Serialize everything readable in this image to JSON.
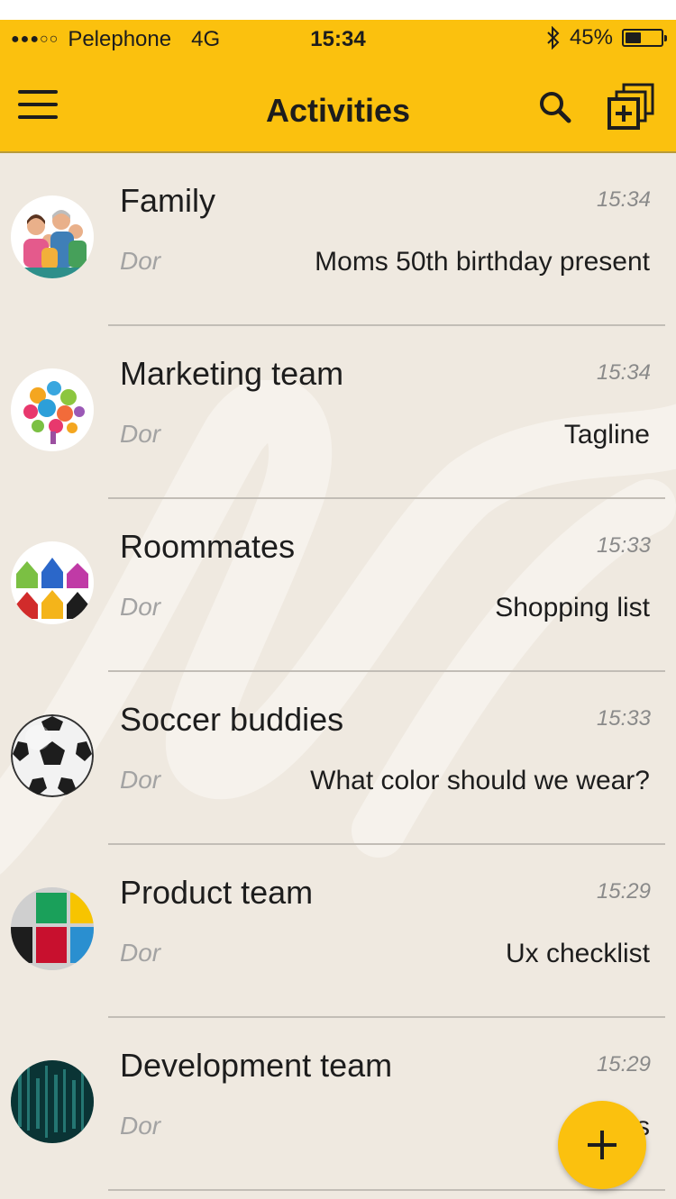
{
  "status_bar": {
    "carrier": "Pelephone",
    "network": "4G",
    "time": "15:34",
    "battery_percent": "45%",
    "battery_level": 0.45,
    "signal_dots": "●●●○○"
  },
  "header": {
    "title": "Activities"
  },
  "activities": [
    {
      "name": "Family",
      "time": "15:34",
      "sender": "Dor",
      "message": "Moms 50th birthday present"
    },
    {
      "name": "Marketing team",
      "time": "15:34",
      "sender": "Dor",
      "message": "Tagline"
    },
    {
      "name": "Roommates",
      "time": "15:33",
      "sender": "Dor",
      "message": "Shopping list"
    },
    {
      "name": "Soccer buddies",
      "time": "15:33",
      "sender": "Dor",
      "message": "What color should we wear?"
    },
    {
      "name": "Product team",
      "time": "15:29",
      "sender": "Dor",
      "message": "Ux checklist"
    },
    {
      "name": "Development team",
      "time": "15:29",
      "sender": "Dor",
      "message": "s"
    }
  ],
  "icons": {
    "menu": "hamburger-menu-icon",
    "search": "search-icon",
    "new_group": "new-group-icon",
    "fab": "plus-icon"
  },
  "colors": {
    "accent": "#fbc10e",
    "background": "#efe9e0"
  }
}
